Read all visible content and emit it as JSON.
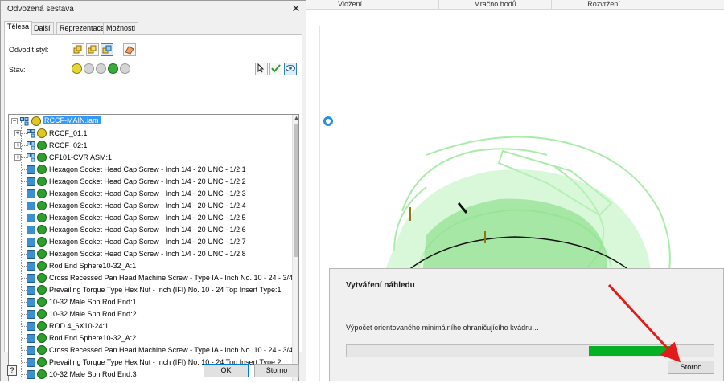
{
  "ribbon": {
    "tabs": [
      "Vložení",
      "Mračno bodů",
      "Rozvržení"
    ]
  },
  "dialog": {
    "title": "Odvozená sestava",
    "close_label": "✕",
    "tabs": [
      "Tělesa",
      "Další",
      "Reprezentace",
      "Možnosti"
    ],
    "active_tab": "Tělesa",
    "derive_style_label": "Odvodit styl:",
    "state_label": "Stav:",
    "tree": {
      "root": "RCCF-MAIN.iam",
      "items": [
        {
          "label": "RCCF_01:1",
          "type": "assembly",
          "state": "yellow",
          "expandable": true
        },
        {
          "label": "RCCF_02:1",
          "type": "assembly",
          "state": "green",
          "expandable": true
        },
        {
          "label": "CF101-CVR ASM:1",
          "type": "assembly",
          "state": "green",
          "expandable": true
        },
        {
          "label": "Hexagon Socket Head Cap Screw - Inch 1/4 - 20 UNC - 1/2:1",
          "type": "part",
          "state": "green"
        },
        {
          "label": "Hexagon Socket Head Cap Screw - Inch 1/4 - 20 UNC - 1/2:2",
          "type": "part",
          "state": "green"
        },
        {
          "label": "Hexagon Socket Head Cap Screw - Inch 1/4 - 20 UNC - 1/2:3",
          "type": "part",
          "state": "green"
        },
        {
          "label": "Hexagon Socket Head Cap Screw - Inch 1/4 - 20 UNC - 1/2:4",
          "type": "part",
          "state": "green"
        },
        {
          "label": "Hexagon Socket Head Cap Screw - Inch 1/4 - 20 UNC - 1/2:5",
          "type": "part",
          "state": "green"
        },
        {
          "label": "Hexagon Socket Head Cap Screw - Inch 1/4 - 20 UNC - 1/2:6",
          "type": "part",
          "state": "green"
        },
        {
          "label": "Hexagon Socket Head Cap Screw - Inch 1/4 - 20 UNC - 1/2:7",
          "type": "part",
          "state": "green"
        },
        {
          "label": "Hexagon Socket Head Cap Screw - Inch 1/4 - 20 UNC - 1/2:8",
          "type": "part",
          "state": "green"
        },
        {
          "label": "Rod End Sphere10-32_A:1",
          "type": "part",
          "state": "green"
        },
        {
          "label": "Cross Recessed Pan Head Machine Screw - Type IA - Inch No. 10 - 24 - 3/4:1",
          "type": "part",
          "state": "green"
        },
        {
          "label": "Prevailing Torque Type Hex Nut - Inch (IFI) No. 10 - 24 Top Insert Type:1",
          "type": "part",
          "state": "green"
        },
        {
          "label": "10-32 Male Sph Rod End:1",
          "type": "part",
          "state": "green"
        },
        {
          "label": "10-32 Male Sph Rod End:2",
          "type": "part",
          "state": "green"
        },
        {
          "label": "ROD 4_6X10-24:1",
          "type": "part",
          "state": "green"
        },
        {
          "label": "Rod End Sphere10-32_A:2",
          "type": "part",
          "state": "green"
        },
        {
          "label": "Cross Recessed Pan Head Machine Screw - Type IA - Inch No. 10 - 24 - 3/4:2",
          "type": "part",
          "state": "green"
        },
        {
          "label": "Prevailing Torque Type Hex Nut - Inch (IFI) No. 10 - 24 Top Insert Type:2",
          "type": "part",
          "state": "green"
        },
        {
          "label": "10-32 Male Sph Rod End:3",
          "type": "part",
          "state": "green"
        }
      ]
    },
    "help_label": "?",
    "ok_label": "OK",
    "cancel_label": "Storno"
  },
  "progress_dialog": {
    "title": "Vytváření náhledu",
    "message": "Výpočet orientovaného minimálního ohraničujícího kvádru…",
    "progress_filled_from": 0.66,
    "progress_filled_to": 0.89,
    "cancel_label": "Storno"
  },
  "colors": {
    "accent": "#0078d7",
    "progress_green": "#06b025",
    "model_green": "#7ee27e"
  }
}
